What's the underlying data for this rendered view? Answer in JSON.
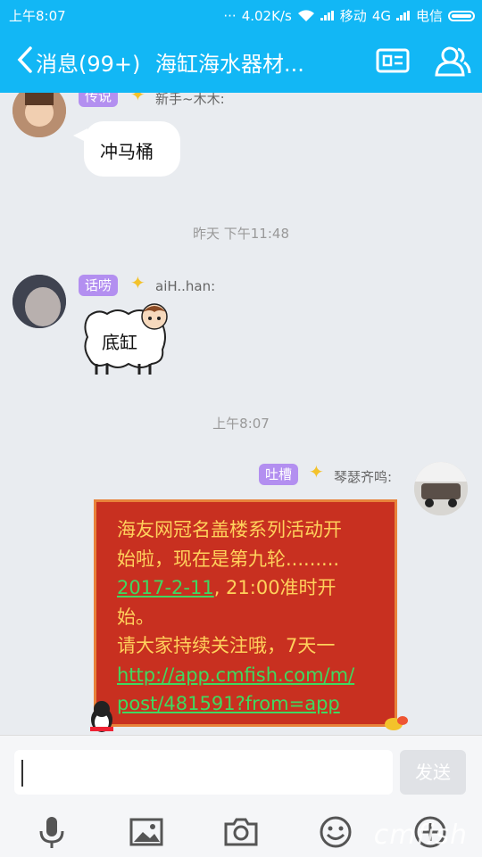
{
  "status": {
    "time": "上午8:07",
    "speed": "4.02K/s",
    "carrier1": "移动",
    "net": "4G",
    "carrier2": "电信"
  },
  "header": {
    "back_label": "消息(99+)",
    "title": "海缸海水器材..."
  },
  "messages": [
    {
      "badge": "传说",
      "nick": "新手~木木:",
      "text": "冲马桶"
    },
    {
      "badge": "话唠",
      "nick": "aiH..han:",
      "text": "底缸"
    },
    {
      "badge": "吐槽",
      "nick": "琴瑟齐鸣:",
      "lines": [
        "海友网冠名盖楼系列活动开",
        "始啦，现在是第九轮.........",
        "2017-2-11",
        ", 21:00准时开",
        "始。",
        "请大家持续关注哦，7天一",
        "http://app.cmfish.com/m/",
        "post/481591?from=app"
      ]
    }
  ],
  "timestamps": [
    "昨天 下午11:48",
    "上午8:07"
  ],
  "input": {
    "value": "",
    "send_label": "发送"
  },
  "toolbar": {
    "icons": [
      "mic-icon",
      "image-icon",
      "camera-icon",
      "emoji-icon",
      "plus-icon"
    ]
  },
  "watermark": "cmfish"
}
